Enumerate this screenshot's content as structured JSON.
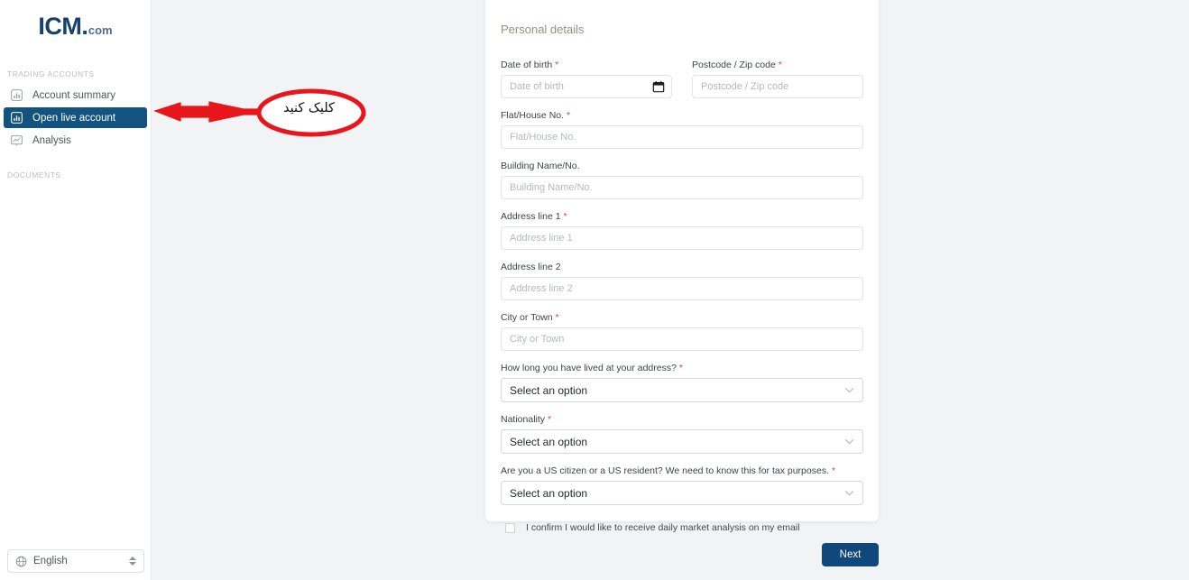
{
  "sidebar": {
    "logo": {
      "main": "ICM",
      "suffix": "com",
      "icon": "icm-logo"
    },
    "sections": [
      {
        "label": "TRADING ACCOUNTS"
      },
      {
        "label": "DOCUMENTS"
      }
    ],
    "items": [
      {
        "label": "Account summary",
        "icon": "bar-chart-icon",
        "active": false
      },
      {
        "label": "Open live account",
        "icon": "bar-chart-icon",
        "active": true
      },
      {
        "label": "Analysis",
        "icon": "analysis-chart-icon",
        "active": false
      }
    ],
    "language_selector": {
      "value": "English",
      "icon": "globe-icon",
      "stepper_icon": "up-down-stepper-icon"
    }
  },
  "annotation": {
    "text": "کلیک کنید",
    "shape": "ellipse-with-left-arrow",
    "color": "#e8151b",
    "meaning": "click here"
  },
  "form": {
    "title": "Personal details",
    "fields": {
      "date_of_birth": {
        "label": "Date of birth",
        "required": true,
        "placeholder": "Date of birth",
        "value": "",
        "icon": "calendar-icon"
      },
      "postcode": {
        "label": "Postcode / Zip code",
        "required": true,
        "placeholder": "Postcode / Zip code",
        "value": ""
      },
      "flat_house_no": {
        "label": "Flat/House No.",
        "required": true,
        "placeholder": "Flat/House No.",
        "value": ""
      },
      "building_name_no": {
        "label": "Building Name/No.",
        "required": false,
        "placeholder": "Building Name/No.",
        "value": ""
      },
      "address_line_1": {
        "label": "Address line 1",
        "required": true,
        "placeholder": "Address line 1",
        "value": ""
      },
      "address_line_2": {
        "label": "Address line 2",
        "required": false,
        "placeholder": "Address line 2",
        "value": ""
      },
      "city_or_town": {
        "label": "City or Town",
        "required": true,
        "placeholder": "City or Town",
        "value": ""
      },
      "time_at_address": {
        "label": "How long you have lived at your address?",
        "required": true,
        "selected": "Select an option",
        "icon": "chevron-down-icon"
      },
      "nationality": {
        "label": "Nationality",
        "required": true,
        "selected": "Select an option",
        "icon": "chevron-down-icon"
      },
      "us_citizen": {
        "label": "Are you a US citizen or a US resident? We need to know this for tax purposes.",
        "required": true,
        "selected": "Select an option",
        "icon": "chevron-down-icon"
      }
    },
    "consent": {
      "label": "I confirm I would like to receive daily market analysis on my email",
      "checked": false
    },
    "next_button": "Next"
  },
  "theme": {
    "brand_navy": "#13537f",
    "logo_navy": "#17426d",
    "button_navy": "#11487c",
    "required_red": "#e0413c",
    "annotation_red": "#e8151b",
    "page_bg": "#f2f3f5",
    "title_color": "#9a8f7e"
  }
}
